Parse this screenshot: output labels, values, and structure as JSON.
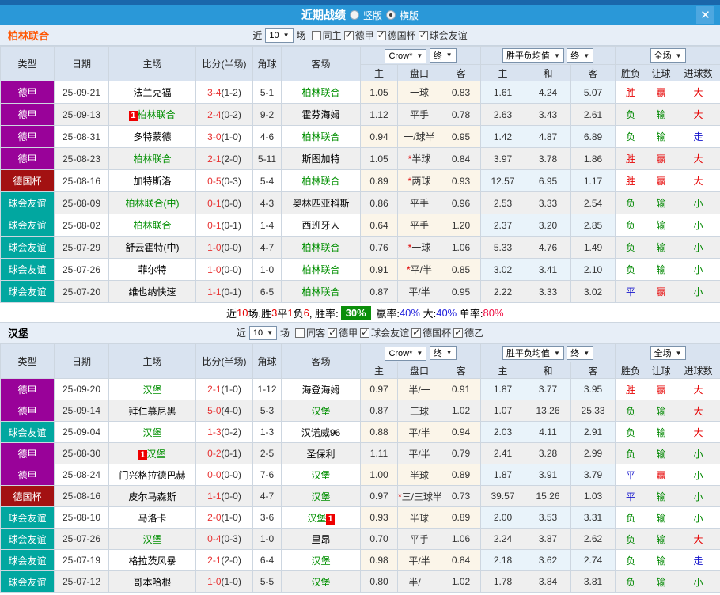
{
  "titlebar": {
    "title": "近期战绩",
    "radio_vertical": "竖版",
    "radio_horizontal": "横版",
    "close": "✕"
  },
  "controls": {
    "near": "近",
    "count": "10",
    "chang": "场",
    "crow": "Crow*",
    "final": "终",
    "avg": "胜平负均值",
    "full": "全场",
    "arrow": "▼"
  },
  "cols": {
    "type": "类型",
    "date": "日期",
    "home": "主场",
    "score": "比分(半场)",
    "corner": "角球",
    "away": "客场",
    "h": "主",
    "hcap": "盘口",
    "a": "客",
    "avg_h": "主",
    "avg_d": "和",
    "avg_a": "客",
    "wl": "胜负",
    "let": "让球",
    "goals": "进球数"
  },
  "team1": {
    "name": "柏林联合",
    "name_color": "#ff5500",
    "filters": [
      {
        "label": "同主",
        "state": "unchecked"
      },
      {
        "label": "德甲",
        "state": "checked"
      },
      {
        "label": "德国杯",
        "state": "checked"
      },
      {
        "label": "球会友谊",
        "state": "checked"
      }
    ],
    "rows": [
      {
        "type": "德甲",
        "type_bg": "#990299",
        "date": "25-09-21",
        "home_b": "",
        "home": "法兰克福",
        "home_c": "#000000",
        "score": "3-4",
        "half": "(1-2)",
        "corner": "5-1",
        "away": "柏林联合",
        "away_c": "#008f00",
        "away_b": "",
        "o1": "1.05",
        "star": "",
        "hc": "一球",
        "o2": "0.83",
        "a1": "1.61",
        "a2": "4.24",
        "a3": "5.07",
        "r1": "胜",
        "r1c": "#e60000",
        "r2": "赢",
        "r2c": "#e60000",
        "r3": "大",
        "r3c": "#e60000"
      },
      {
        "type": "德甲",
        "type_bg": "#990299",
        "date": "25-09-13",
        "home_b": "1",
        "home": "柏林联合",
        "home_c": "#008f00",
        "score": "2-4",
        "half": "(0-2)",
        "corner": "9-2",
        "away": "霍芬海姆",
        "away_c": "#000000",
        "away_b": "",
        "o1": "1.12",
        "star": "",
        "hc": "平手",
        "o2": "0.78",
        "a1": "2.63",
        "a2": "3.43",
        "a3": "2.61",
        "r1": "负",
        "r1c": "#008800",
        "r2": "输",
        "r2c": "#008800",
        "r3": "大",
        "r3c": "#e60000"
      },
      {
        "type": "德甲",
        "type_bg": "#990299",
        "date": "25-08-31",
        "home_b": "",
        "home": "多特蒙德",
        "home_c": "#000000",
        "score": "3-0",
        "half": "(1-0)",
        "corner": "4-6",
        "away": "柏林联合",
        "away_c": "#008f00",
        "away_b": "",
        "o1": "0.94",
        "star": "",
        "hc": "一/球半",
        "o2": "0.95",
        "a1": "1.42",
        "a2": "4.87",
        "a3": "6.89",
        "r1": "负",
        "r1c": "#008800",
        "r2": "输",
        "r2c": "#008800",
        "r3": "走",
        "r3c": "#1515cc"
      },
      {
        "type": "德甲",
        "type_bg": "#990299",
        "date": "25-08-23",
        "home_b": "",
        "home": "柏林联合",
        "home_c": "#008f00",
        "score": "2-1",
        "half": "(2-0)",
        "corner": "5-11",
        "away": "斯图加特",
        "away_c": "#000000",
        "away_b": "",
        "o1": "1.05",
        "star": "*",
        "hc": "半球",
        "o2": "0.84",
        "a1": "3.97",
        "a2": "3.78",
        "a3": "1.86",
        "r1": "胜",
        "r1c": "#e60000",
        "r2": "赢",
        "r2c": "#e60000",
        "r3": "大",
        "r3c": "#e60000"
      },
      {
        "type": "德国杯",
        "type_bg": "#a31112",
        "date": "25-08-16",
        "home_b": "",
        "home": "加特斯洛",
        "home_c": "#000000",
        "score": "0-5",
        "half": "(0-3)",
        "corner": "5-4",
        "away": "柏林联合",
        "away_c": "#008f00",
        "away_b": "",
        "o1": "0.89",
        "star": "*",
        "hc": "两球",
        "o2": "0.93",
        "a1": "12.57",
        "a2": "6.95",
        "a3": "1.17",
        "r1": "胜",
        "r1c": "#e60000",
        "r2": "赢",
        "r2c": "#e60000",
        "r3": "大",
        "r3c": "#e60000"
      },
      {
        "type": "球会友谊",
        "type_bg": "#01a7a0",
        "date": "25-08-09",
        "home_b": "",
        "home": "柏林联合(中)",
        "home_c": "#008f00",
        "score": "0-1",
        "half": "(0-0)",
        "corner": "4-3",
        "away": "奥林匹亚科斯",
        "away_c": "#000000",
        "away_b": "",
        "o1": "0.86",
        "star": "",
        "hc": "平手",
        "o2": "0.96",
        "a1": "2.53",
        "a2": "3.33",
        "a3": "2.54",
        "r1": "负",
        "r1c": "#008800",
        "r2": "输",
        "r2c": "#008800",
        "r3": "小",
        "r3c": "#008800"
      },
      {
        "type": "球会友谊",
        "type_bg": "#01a7a0",
        "date": "25-08-02",
        "home_b": "",
        "home": "柏林联合",
        "home_c": "#008f00",
        "score": "0-1",
        "half": "(0-1)",
        "corner": "1-4",
        "away": "西班牙人",
        "away_c": "#000000",
        "away_b": "",
        "o1": "0.64",
        "star": "",
        "hc": "平手",
        "o2": "1.20",
        "a1": "2.37",
        "a2": "3.20",
        "a3": "2.85",
        "r1": "负",
        "r1c": "#008800",
        "r2": "输",
        "r2c": "#008800",
        "r3": "小",
        "r3c": "#008800"
      },
      {
        "type": "球会友谊",
        "type_bg": "#01a7a0",
        "date": "25-07-29",
        "home_b": "",
        "home": "舒云霍特(中)",
        "home_c": "#000000",
        "score": "1-0",
        "half": "(0-0)",
        "corner": "4-7",
        "away": "柏林联合",
        "away_c": "#008f00",
        "away_b": "",
        "o1": "0.76",
        "star": "*",
        "hc": "一球",
        "o2": "1.06",
        "a1": "5.33",
        "a2": "4.76",
        "a3": "1.49",
        "r1": "负",
        "r1c": "#008800",
        "r2": "输",
        "r2c": "#008800",
        "r3": "小",
        "r3c": "#008800"
      },
      {
        "type": "球会友谊",
        "type_bg": "#01a7a0",
        "date": "25-07-26",
        "home_b": "",
        "home": "菲尔特",
        "home_c": "#000000",
        "score": "1-0",
        "half": "(0-0)",
        "corner": "1-0",
        "away": "柏林联合",
        "away_c": "#008f00",
        "away_b": "",
        "o1": "0.91",
        "star": "*",
        "hc": "平/半",
        "o2": "0.85",
        "a1": "3.02",
        "a2": "3.41",
        "a3": "2.10",
        "r1": "负",
        "r1c": "#008800",
        "r2": "输",
        "r2c": "#008800",
        "r3": "小",
        "r3c": "#008800"
      },
      {
        "type": "球会友谊",
        "type_bg": "#01a7a0",
        "date": "25-07-20",
        "home_b": "",
        "home": "维也纳快速",
        "home_c": "#000000",
        "score": "1-1",
        "half": "(0-1)",
        "corner": "6-5",
        "away": "柏林联合",
        "away_c": "#008f00",
        "away_b": "",
        "o1": "0.87",
        "star": "",
        "hc": "平/半",
        "o2": "0.95",
        "a1": "2.22",
        "a2": "3.33",
        "a3": "3.02",
        "r1": "平",
        "r1c": "#1515cc",
        "r2": "赢",
        "r2c": "#e60000",
        "r3": "小",
        "r3c": "#008800"
      }
    ],
    "summary": [
      {
        "t": "近",
        "c": "#000000"
      },
      {
        "t": "10",
        "c": "#e60000"
      },
      {
        "t": "场,胜",
        "c": "#000000"
      },
      {
        "t": "3",
        "c": "#e60000"
      },
      {
        "t": "平",
        "c": "#000000"
      },
      {
        "t": "1",
        "c": "#e60000"
      },
      {
        "t": "负",
        "c": "#000000"
      },
      {
        "t": "6",
        "c": "#e60000"
      },
      {
        "t": ", 胜率:",
        "c": "#000000"
      },
      {
        "t": "30%",
        "c": "#ffffff",
        "bg": "#0b8f0b"
      },
      {
        "t": " 赢率:",
        "c": "#000000"
      },
      {
        "t": "40%",
        "c": "#2222dd"
      },
      {
        "t": " 大:",
        "c": "#000000"
      },
      {
        "t": "40%",
        "c": "#2222dd"
      },
      {
        "t": " 单率:",
        "c": "#000000"
      },
      {
        "t": "80%",
        "c": "#ee1144"
      }
    ]
  },
  "team2": {
    "name": "汉堡",
    "name_color": "#000000",
    "filters": [
      {
        "label": "同客",
        "state": "unchecked"
      },
      {
        "label": "德甲",
        "state": "checked"
      },
      {
        "label": "球会友谊",
        "state": "checked"
      },
      {
        "label": "德国杯",
        "state": "checked"
      },
      {
        "label": "德乙",
        "state": "checked"
      }
    ],
    "rows": [
      {
        "type": "德甲",
        "type_bg": "#990299",
        "date": "25-09-20",
        "home_b": "",
        "home": "汉堡",
        "home_c": "#008f00",
        "score": "2-1",
        "half": "(1-0)",
        "corner": "1-12",
        "away": "海登海姆",
        "away_c": "#000000",
        "away_b": "",
        "o1": "0.97",
        "star": "",
        "hc": "半/一",
        "o2": "0.91",
        "a1": "1.87",
        "a2": "3.77",
        "a3": "3.95",
        "r1": "胜",
        "r1c": "#e60000",
        "r2": "赢",
        "r2c": "#e60000",
        "r3": "大",
        "r3c": "#e60000"
      },
      {
        "type": "德甲",
        "type_bg": "#990299",
        "date": "25-09-14",
        "home_b": "",
        "home": "拜仁慕尼黑",
        "home_c": "#000000",
        "score": "5-0",
        "half": "(4-0)",
        "corner": "5-3",
        "away": "汉堡",
        "away_c": "#008f00",
        "away_b": "",
        "o1": "0.87",
        "star": "",
        "hc": "三球",
        "o2": "1.02",
        "a1": "1.07",
        "a2": "13.26",
        "a3": "25.33",
        "r1": "负",
        "r1c": "#008800",
        "r2": "输",
        "r2c": "#008800",
        "r3": "大",
        "r3c": "#e60000"
      },
      {
        "type": "球会友谊",
        "type_bg": "#01a7a0",
        "date": "25-09-04",
        "home_b": "",
        "home": "汉堡",
        "home_c": "#008f00",
        "score": "1-3",
        "half": "(0-2)",
        "corner": "1-3",
        "away": "汉诺威96",
        "away_c": "#000000",
        "away_b": "",
        "o1": "0.88",
        "star": "",
        "hc": "平/半",
        "o2": "0.94",
        "a1": "2.03",
        "a2": "4.11",
        "a3": "2.91",
        "r1": "负",
        "r1c": "#008800",
        "r2": "输",
        "r2c": "#008800",
        "r3": "大",
        "r3c": "#e60000"
      },
      {
        "type": "德甲",
        "type_bg": "#990299",
        "date": "25-08-30",
        "home_b": "1",
        "home": "汉堡",
        "home_c": "#008f00",
        "score": "0-2",
        "half": "(0-1)",
        "corner": "2-5",
        "away": "圣保利",
        "away_c": "#000000",
        "away_b": "",
        "o1": "1.11",
        "star": "",
        "hc": "平/半",
        "o2": "0.79",
        "a1": "2.41",
        "a2": "3.28",
        "a3": "2.99",
        "r1": "负",
        "r1c": "#008800",
        "r2": "输",
        "r2c": "#008800",
        "r3": "小",
        "r3c": "#008800"
      },
      {
        "type": "德甲",
        "type_bg": "#990299",
        "date": "25-08-24",
        "home_b": "",
        "home": "门兴格拉德巴赫",
        "home_c": "#000000",
        "score": "0-0",
        "half": "(0-0)",
        "corner": "7-6",
        "away": "汉堡",
        "away_c": "#008f00",
        "away_b": "",
        "o1": "1.00",
        "star": "",
        "hc": "半球",
        "o2": "0.89",
        "a1": "1.87",
        "a2": "3.91",
        "a3": "3.79",
        "r1": "平",
        "r1c": "#1515cc",
        "r2": "赢",
        "r2c": "#e60000",
        "r3": "小",
        "r3c": "#008800"
      },
      {
        "type": "德国杯",
        "type_bg": "#a31112",
        "date": "25-08-16",
        "home_b": "",
        "home": "皮尔马森斯",
        "home_c": "#000000",
        "score": "1-1",
        "half": "(0-0)",
        "corner": "4-7",
        "away": "汉堡",
        "away_c": "#008f00",
        "away_b": "",
        "o1": "0.97",
        "star": "*",
        "hc": "三/三球半",
        "o2": "0.73",
        "a1": "39.57",
        "a2": "15.26",
        "a3": "1.03",
        "r1": "平",
        "r1c": "#1515cc",
        "r2": "输",
        "r2c": "#008800",
        "r3": "小",
        "r3c": "#008800"
      },
      {
        "type": "球会友谊",
        "type_bg": "#01a7a0",
        "date": "25-08-10",
        "home_b": "",
        "home": "马洛卡",
        "home_c": "#000000",
        "score": "2-0",
        "half": "(1-0)",
        "corner": "3-6",
        "away": "汉堡",
        "away_c": "#008f00",
        "away_b": "1",
        "o1": "0.93",
        "star": "",
        "hc": "半球",
        "o2": "0.89",
        "a1": "2.00",
        "a2": "3.53",
        "a3": "3.31",
        "r1": "负",
        "r1c": "#008800",
        "r2": "输",
        "r2c": "#008800",
        "r3": "小",
        "r3c": "#008800"
      },
      {
        "type": "球会友谊",
        "type_bg": "#01a7a0",
        "date": "25-07-26",
        "home_b": "",
        "home": "汉堡",
        "home_c": "#008f00",
        "score": "0-4",
        "half": "(0-3)",
        "corner": "1-0",
        "away": "里昂",
        "away_c": "#000000",
        "away_b": "",
        "o1": "0.70",
        "star": "",
        "hc": "平手",
        "o2": "1.06",
        "a1": "2.24",
        "a2": "3.87",
        "a3": "2.62",
        "r1": "负",
        "r1c": "#008800",
        "r2": "输",
        "r2c": "#008800",
        "r3": "大",
        "r3c": "#e60000"
      },
      {
        "type": "球会友谊",
        "type_bg": "#01a7a0",
        "date": "25-07-19",
        "home_b": "",
        "home": "格拉茨风暴",
        "home_c": "#000000",
        "score": "2-1",
        "half": "(2-0)",
        "corner": "6-4",
        "away": "汉堡",
        "away_c": "#008f00",
        "away_b": "",
        "o1": "0.98",
        "star": "",
        "hc": "平/半",
        "o2": "0.84",
        "a1": "2.18",
        "a2": "3.62",
        "a3": "2.74",
        "r1": "负",
        "r1c": "#008800",
        "r2": "输",
        "r2c": "#008800",
        "r3": "走",
        "r3c": "#1515cc"
      },
      {
        "type": "球会友谊",
        "type_bg": "#01a7a0",
        "date": "25-07-12",
        "home_b": "",
        "home": "哥本哈根",
        "home_c": "#000000",
        "score": "1-0",
        "half": "(1-0)",
        "corner": "5-5",
        "away": "汉堡",
        "away_c": "#008f00",
        "away_b": "",
        "o1": "0.80",
        "star": "",
        "hc": "半/一",
        "o2": "1.02",
        "a1": "1.78",
        "a2": "3.84",
        "a3": "3.81",
        "r1": "负",
        "r1c": "#008800",
        "r2": "输",
        "r2c": "#008800",
        "r3": "小",
        "r3c": "#008800"
      }
    ]
  }
}
